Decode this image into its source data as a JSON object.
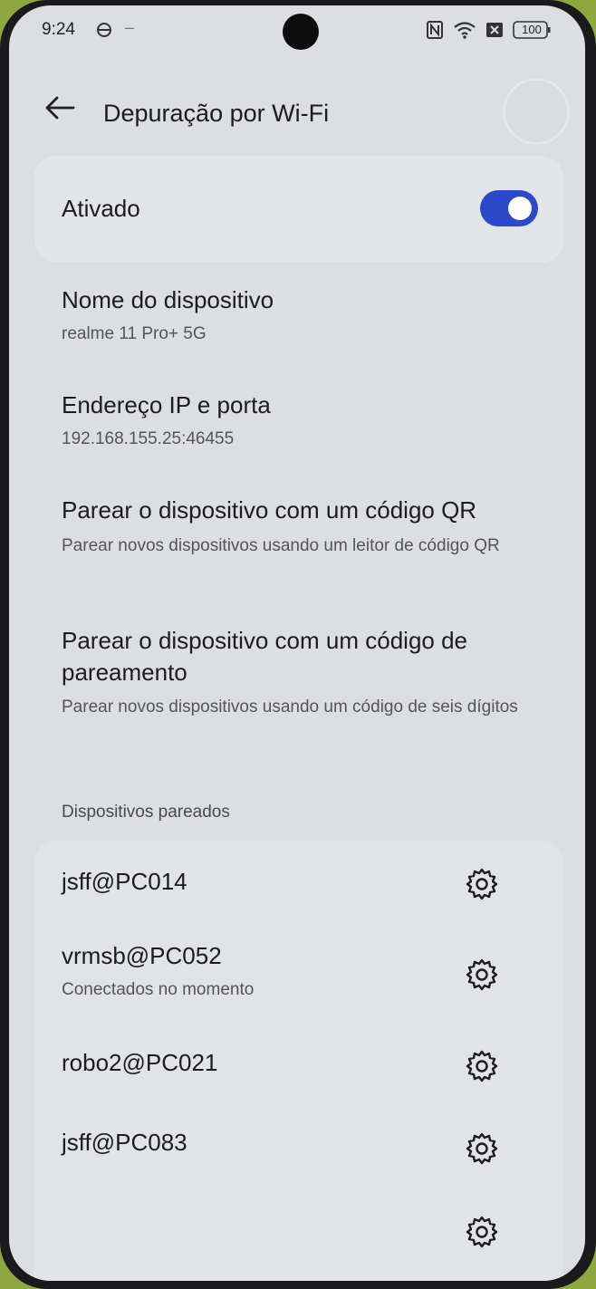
{
  "status_bar": {
    "time": "9:24",
    "battery": "100"
  },
  "header": {
    "title": "Depuração por Wi-Fi"
  },
  "toggle_card": {
    "label": "Ativado",
    "state": "on"
  },
  "settings": [
    {
      "title": "Nome do dispositivo",
      "subtitle": "realme 11 Pro+ 5G"
    },
    {
      "title": "Endereço IP e porta",
      "subtitle": "192.168.155.25:46455"
    },
    {
      "title": "Parear o dispositivo com um código QR",
      "subtitle": "Parear novos dispositivos usando um leitor de código QR"
    },
    {
      "title": "Parear o dispositivo com um código de pareamento",
      "subtitle": "Parear novos dispositivos usando um código de seis dígitos"
    }
  ],
  "paired_section": {
    "label": "Dispositivos pareados",
    "devices": [
      {
        "name": "jsff@PC014",
        "status": ""
      },
      {
        "name": "vrmsb@PC052",
        "status": "Conectados no momento"
      },
      {
        "name": "robo2@PC021",
        "status": ""
      },
      {
        "name": "jsff@PC083",
        "status": ""
      }
    ]
  },
  "colors": {
    "accent": "#2b49c9",
    "background": "#dcdee2"
  }
}
